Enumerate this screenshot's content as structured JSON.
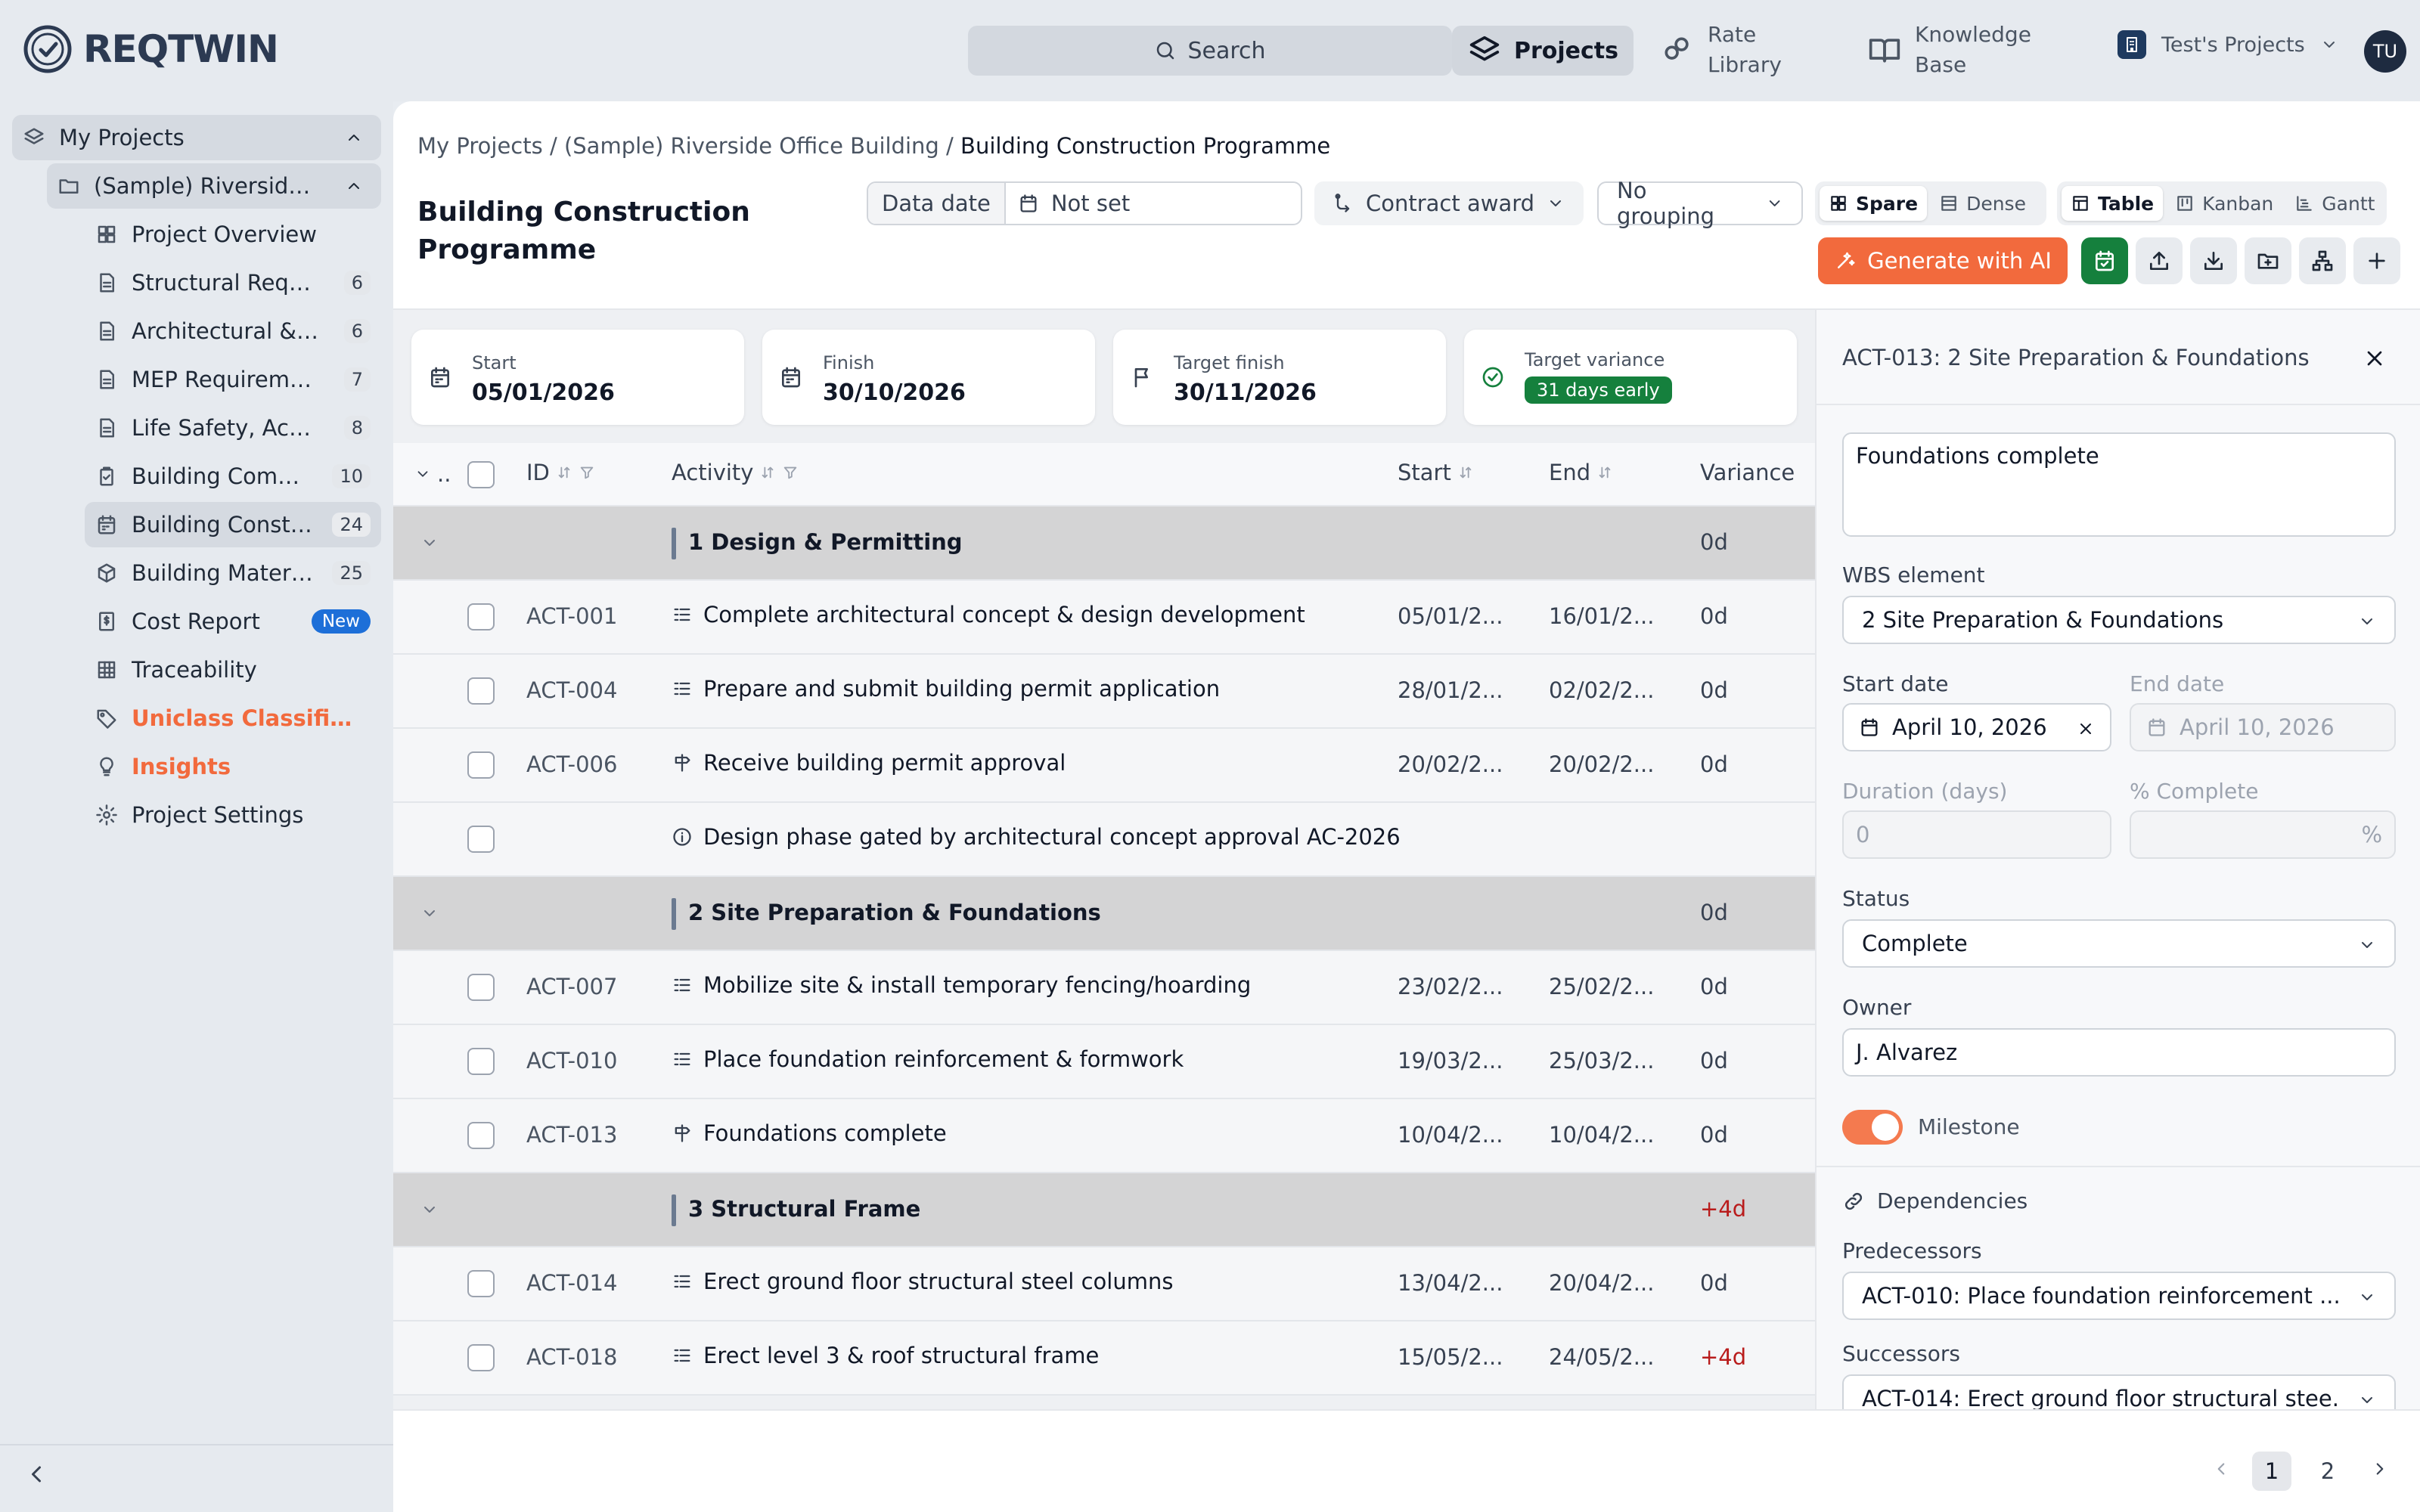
{
  "brand": {
    "name": "REQTWIN"
  },
  "topnav": {
    "search_label": "Search",
    "projects_label": "Projects",
    "rate_library_label": "Rate Library",
    "knowledge_base_label": "Knowledge Base",
    "workspace_label": "Test's Projects",
    "avatar_initials": "TU"
  },
  "sidebar": {
    "root": "My Projects",
    "project": "(Sample) Riverside Office Building",
    "items": [
      {
        "label": "Project Overview",
        "icon": "grid-icon",
        "count": ""
      },
      {
        "label": "Structural Requirements",
        "icon": "document-icon",
        "count": "6"
      },
      {
        "label": "Architectural & Interior",
        "icon": "document-icon",
        "count": "6"
      },
      {
        "label": "MEP Requirements",
        "icon": "document-icon",
        "count": "7"
      },
      {
        "label": "Life Safety, Accessibility",
        "icon": "document-icon",
        "count": "8"
      },
      {
        "label": "Building Compliance",
        "icon": "clipboard-icon",
        "count": "10"
      },
      {
        "label": "Building Construction Programme",
        "icon": "calendar-icon",
        "count": "24"
      },
      {
        "label": "Building Materials",
        "icon": "cube-icon",
        "count": "25"
      },
      {
        "label": "Cost Report",
        "icon": "cost-icon",
        "count": "",
        "badge": "New"
      },
      {
        "label": "Traceability",
        "icon": "table-icon",
        "count": ""
      },
      {
        "label": "Uniclass Classification",
        "icon": "tag-icon",
        "count": ""
      },
      {
        "label": "Insights",
        "icon": "bulb-icon",
        "count": ""
      },
      {
        "label": "Project Settings",
        "icon": "gear-icon",
        "count": ""
      }
    ]
  },
  "breadcrumb": {
    "part1": "My Projects",
    "sep": "/",
    "part2": "(Sample) Riverside Office Building",
    "current": "Building Construction Programme"
  },
  "page": {
    "title": "Building Construction Programme",
    "data_date_label": "Data date",
    "data_date_value": "Not set",
    "baseline": "Contract award",
    "grouping": "No grouping",
    "density": [
      "Spare",
      "Dense"
    ],
    "density_selected": "Spare",
    "views": [
      "Table",
      "Kanban",
      "Gantt"
    ],
    "view_selected": "Table",
    "generate_ai": "Generate with AI"
  },
  "summary": {
    "start_label": "Start",
    "start_value": "05/01/2026",
    "finish_label": "Finish",
    "finish_value": "30/10/2026",
    "target_label": "Target finish",
    "target_value": "30/11/2026",
    "variance_label": "Target variance",
    "variance_value": "31 days early"
  },
  "table": {
    "columns": {
      "expand": "..",
      "id": "ID",
      "activity": "Activity",
      "start": "Start",
      "end": "End",
      "variance": "Variance"
    },
    "rows": [
      {
        "type": "group",
        "name": "1 Design & Permitting",
        "variance": "0d"
      },
      {
        "type": "task",
        "id": "ACT-001",
        "icon": "task-list-icon",
        "activity": "Complete architectural concept & design development",
        "start": "05/01/2...",
        "end": "16/01/2...",
        "variance": "0d"
      },
      {
        "type": "task",
        "id": "ACT-004",
        "icon": "task-list-icon",
        "activity": "Prepare and submit building permit application",
        "start": "28/01/2...",
        "end": "02/02/2...",
        "variance": "0d"
      },
      {
        "type": "task",
        "id": "ACT-006",
        "icon": "milestone-signpost-icon",
        "activity": "Receive building permit approval",
        "start": "20/02/2...",
        "end": "20/02/2...",
        "variance": "0d"
      },
      {
        "type": "note",
        "id": "",
        "icon": "info-icon",
        "activity": "Design phase gated by architectural concept approval AC-2026",
        "start": "",
        "end": "",
        "variance": ""
      },
      {
        "type": "group",
        "name": "2 Site Preparation & Foundations",
        "variance": "0d"
      },
      {
        "type": "task",
        "id": "ACT-007",
        "icon": "task-list-icon",
        "activity": "Mobilize site & install temporary fencing/hoarding",
        "start": "23/02/2...",
        "end": "25/02/2...",
        "variance": "0d"
      },
      {
        "type": "task",
        "id": "ACT-010",
        "icon": "task-list-icon",
        "activity": "Place foundation reinforcement & formwork",
        "start": "19/03/2...",
        "end": "25/03/2...",
        "variance": "0d"
      },
      {
        "type": "task",
        "id": "ACT-013",
        "icon": "milestone-signpost-icon",
        "activity": "Foundations complete",
        "start": "10/04/2...",
        "end": "10/04/2...",
        "variance": "0d"
      },
      {
        "type": "group",
        "name": "3 Structural Frame",
        "variance": "+4d"
      },
      {
        "type": "task",
        "id": "ACT-014",
        "icon": "task-list-icon",
        "activity": "Erect ground floor structural steel columns",
        "start": "13/04/2...",
        "end": "20/04/2...",
        "variance": "0d"
      },
      {
        "type": "task",
        "id": "ACT-018",
        "icon": "task-list-icon",
        "activity": "Erect level 3 & roof structural frame",
        "start": "15/05/2...",
        "end": "24/05/2...",
        "variance": "+4d"
      }
    ]
  },
  "panel": {
    "title": "ACT-013: 2 Site Preparation & Foundations",
    "name_value": "Foundations complete",
    "wbs_label": "WBS element",
    "wbs_value": "2 Site Preparation & Foundations",
    "start_label": "Start date",
    "start_value": "April 10, 2026",
    "end_label": "End date",
    "end_value": "April 10, 2026",
    "duration_label": "Duration (days)",
    "duration_value": "0",
    "complete_label": "% Complete",
    "complete_unit": "%",
    "status_label": "Status",
    "status_value": "Complete",
    "owner_label": "Owner",
    "owner_value": "J. Alvarez",
    "milestone_label": "Milestone",
    "milestone_on": true,
    "deps_label": "Dependencies",
    "pred_label": "Predecessors",
    "pred_value": "ACT-010: Place foundation reinforcement ...",
    "succ_label": "Successors",
    "succ_value": "ACT-014: Erect ground floor structural stee..."
  },
  "pagination": {
    "pages": [
      "1",
      "2"
    ],
    "current": "1"
  },
  "colors": {
    "accent": "#f26a3d",
    "success": "#15803d",
    "danger": "#b91c1c",
    "brand_dark": "#2c3a52"
  }
}
